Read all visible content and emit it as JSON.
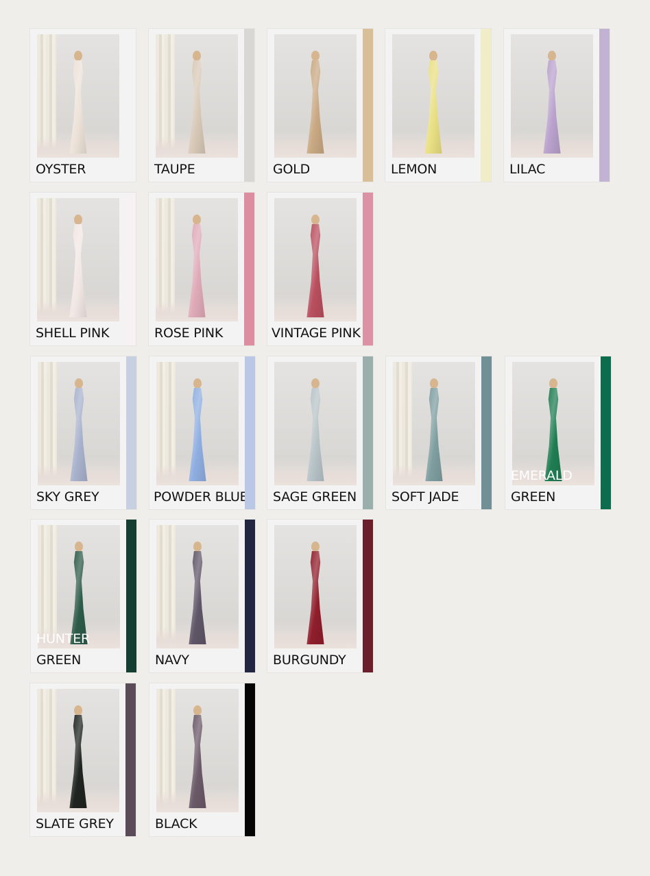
{
  "colours": [
    {
      "label": "OYSTER",
      "swatch": "#f3f3f3",
      "dress": "#ece2d8"
    },
    {
      "label": "TAUPE",
      "swatch": "#d9d7d4",
      "dress": "#d8c9b7"
    },
    {
      "label": "GOLD",
      "swatch": "#d9bf98",
      "dress": "#c9a984"
    },
    {
      "label": "LEMON",
      "swatch": "#f1edc8",
      "dress": "#e9df84"
    },
    {
      "label": "LILAC",
      "swatch": "#c2b3d3",
      "dress": "#b9a2cd"
    },
    {
      "label": "SHELL PINK",
      "swatch": "#f6f1f3",
      "dress": "#f1e7e4"
    },
    {
      "label": "ROSE PINK",
      "swatch": "#dc8d9f",
      "dress": "#dfaab8"
    },
    {
      "label": "VINTAGE PINK",
      "swatch": "#db92a4",
      "dress": "#b84f5e"
    },
    {
      "label": "SKY GREY",
      "swatch": "#c7d0e1",
      "dress": "#a8b2cc"
    },
    {
      "label": "POWDER BLUE",
      "swatch": "#bac8e5",
      "dress": "#8faee0"
    },
    {
      "label": "SAGE GREEN",
      "swatch": "#9aafac",
      "dress": "#b7c3c7"
    },
    {
      "label": "SOFT JADE",
      "swatch": "#719096",
      "dress": "#7f9ea0"
    },
    {
      "label": "EMERALD",
      "label_2": "GREEN",
      "swatch": "#0c6c4e",
      "dress": "#1f7d52"
    },
    {
      "label": "HUNTER",
      "label_2": "GREEN",
      "swatch": "#153e32",
      "dress": "#2d5b49"
    },
    {
      "label": "NAVY",
      "swatch": "#232641",
      "dress": "#5f5667"
    },
    {
      "label": "BURGUNDY",
      "swatch": "#6b1f2d",
      "dress": "#8f1e2b"
    },
    {
      "label": "SLATE GREY",
      "swatch": "#5a4b59",
      "dress": "#1f2420"
    },
    {
      "label": "BLACK",
      "swatch": "#050505",
      "dress": "#6a5967"
    }
  ]
}
